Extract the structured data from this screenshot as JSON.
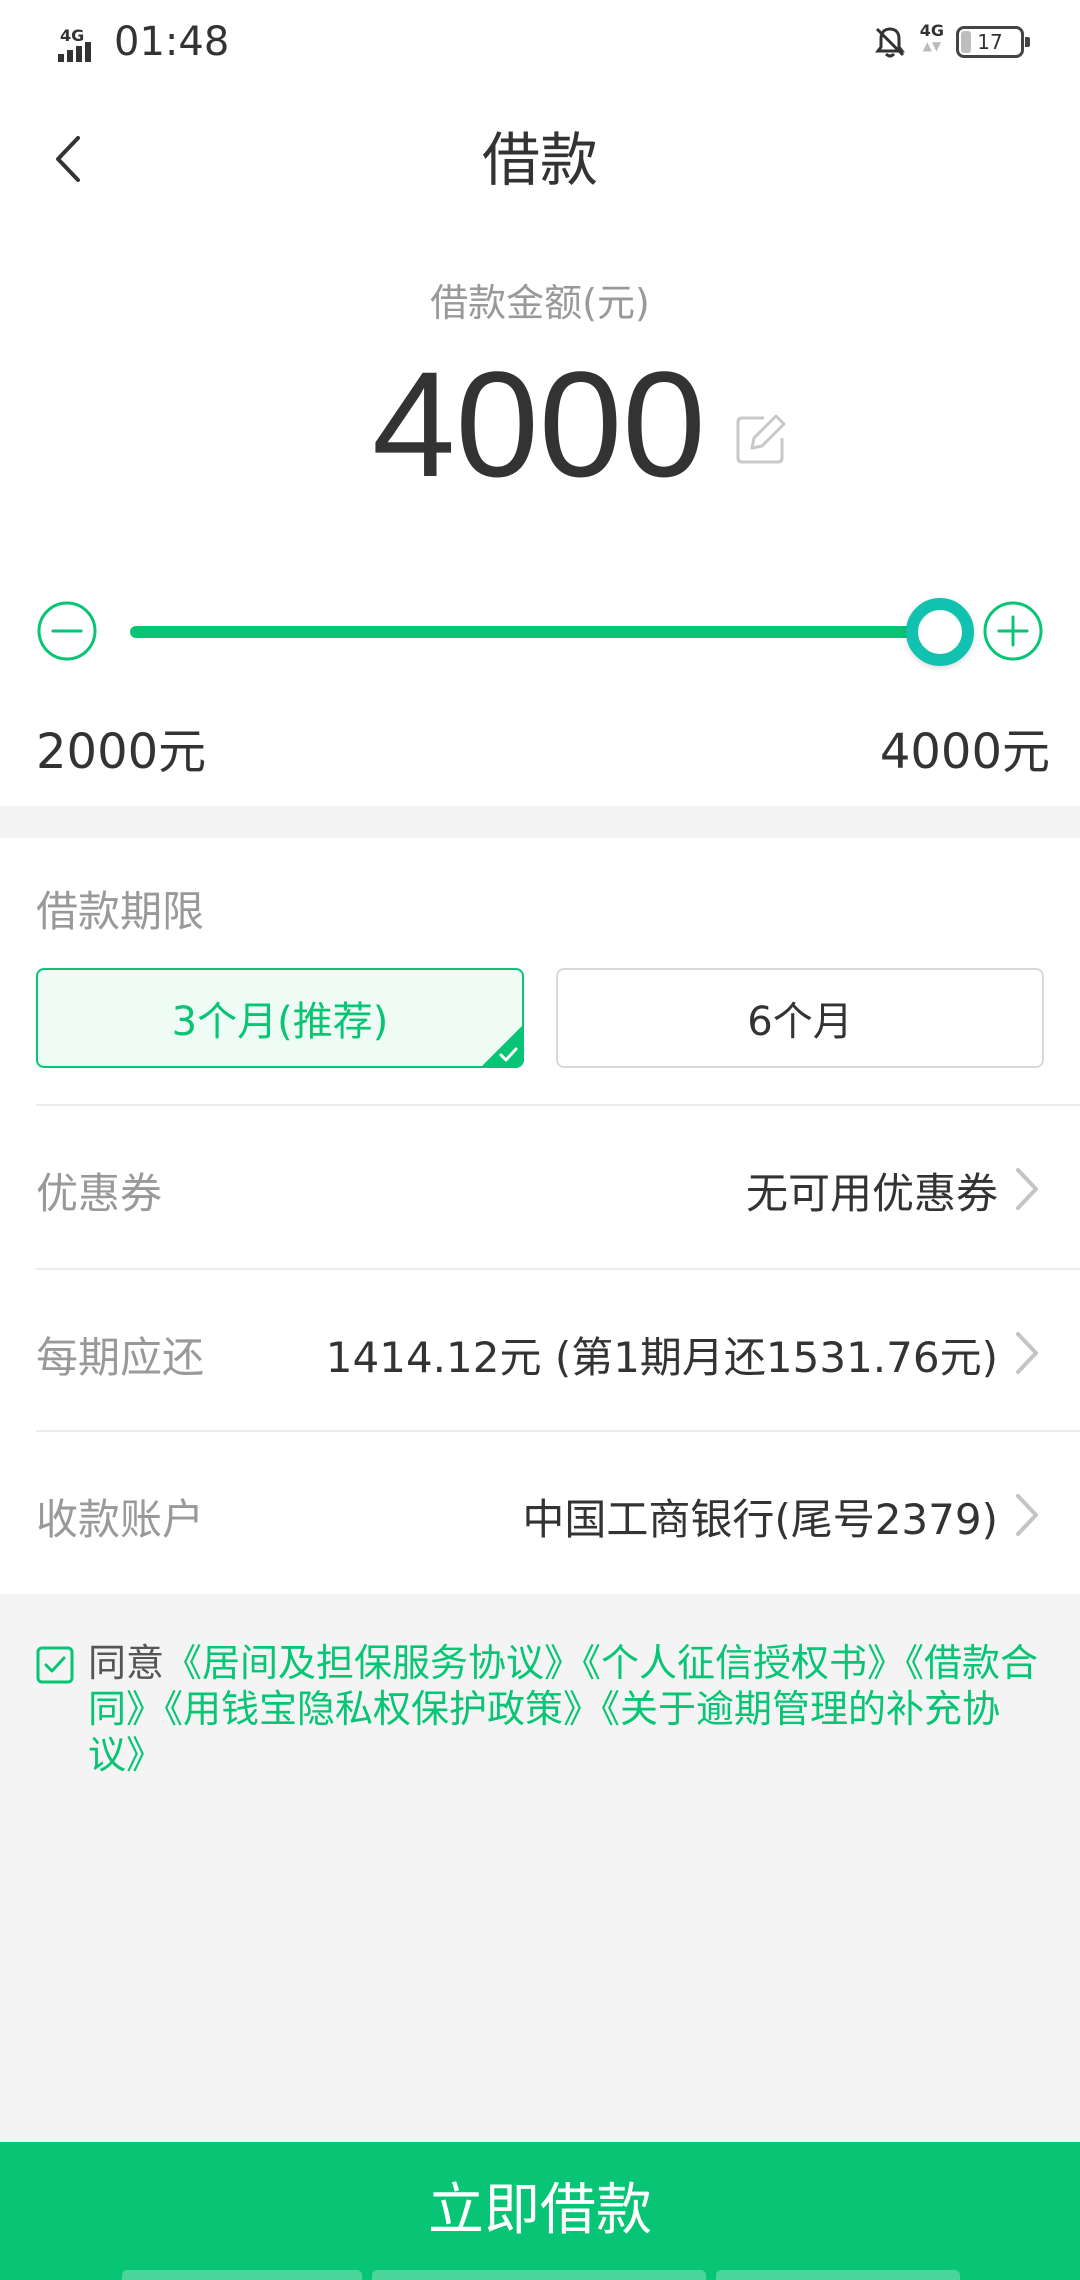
{
  "status_bar": {
    "network_left": "4G",
    "time": "01:48",
    "network_right": "4G",
    "battery": "17"
  },
  "header": {
    "title": "借款"
  },
  "amount": {
    "label": "借款金额(元)",
    "value": "4000",
    "slider": {
      "min_label": "2000元",
      "max_label": "4000元",
      "min": 2000,
      "max": 4000,
      "current": 4000
    }
  },
  "term": {
    "label": "借款期限",
    "options": [
      {
        "label": "3个月(推荐)",
        "selected": true
      },
      {
        "label": "6个月",
        "selected": false
      }
    ]
  },
  "rows": [
    {
      "label": "优惠券",
      "value": "无可用优惠券"
    },
    {
      "label": "每期应还",
      "value": "1414.12元 (第1期月还1531.76元)"
    },
    {
      "label": "收款账户",
      "value": "中国工商银行(尾号2379)"
    }
  ],
  "agreement": {
    "checked": true,
    "prefix": "同意",
    "links": [
      "《居间及担保服务协议》",
      "《个人征信授权书》",
      "《借款合同》",
      "《用钱宝隐私权保护政策》",
      "《关于逾期管理的补充协议》"
    ]
  },
  "submit": {
    "label": "立即借款"
  },
  "colors": {
    "accent": "#07c574",
    "thumb": "#11c2b0",
    "selected_bg": "#effbf5"
  }
}
